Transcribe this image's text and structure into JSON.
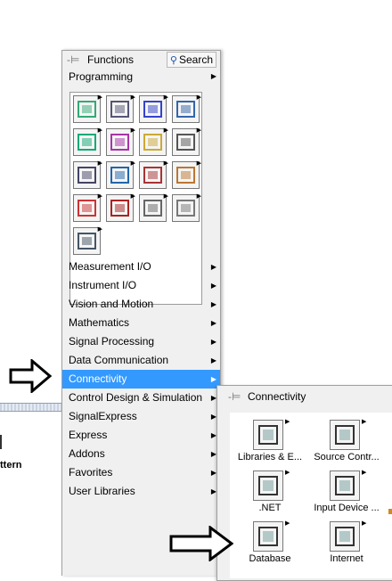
{
  "palette": {
    "title": "Functions",
    "search_label": "Search",
    "top_category": "Programming",
    "icons": [
      "structures-icon",
      "array-icon",
      "cluster-icon",
      "numeric-icon",
      "boolean-icon",
      "string-icon",
      "comparison-icon",
      "timing-icon",
      "dialog-ui-icon",
      "file-io-icon",
      "waveform-icon",
      "app-control-icon",
      "synchronization-icon",
      "graphics-sound-icon",
      "report-generation-icon",
      "bug-icon",
      "instrument-icon"
    ],
    "categories": [
      {
        "label": "Measurement I/O"
      },
      {
        "label": "Instrument I/O"
      },
      {
        "label": "Vision and Motion"
      },
      {
        "label": "Mathematics"
      },
      {
        "label": "Signal Processing"
      },
      {
        "label": "Data Communication"
      },
      {
        "label": "Connectivity"
      },
      {
        "label": "Control Design & Simulation"
      },
      {
        "label": "SignalExpress"
      },
      {
        "label": "Express"
      },
      {
        "label": "Addons"
      },
      {
        "label": "Favorites"
      },
      {
        "label": "User Libraries"
      }
    ],
    "selected": "Connectivity"
  },
  "submenu": {
    "title": "Connectivity",
    "items": [
      {
        "label": "Libraries & E...",
        "icon": "libraries-icon"
      },
      {
        "label": "Source Contr...",
        "icon": "source-control-icon"
      },
      {
        "label": ".NET",
        "icon": "dotnet-icon"
      },
      {
        "label": "Input Device ...",
        "icon": "input-device-icon"
      },
      {
        "label": "Database",
        "icon": "database-icon"
      },
      {
        "label": "Internet",
        "icon": "internet-icon"
      }
    ]
  },
  "background": {
    "text": "ttern"
  },
  "colors": {
    "selection": "#3399ff",
    "panel": "#f0f0f0"
  }
}
